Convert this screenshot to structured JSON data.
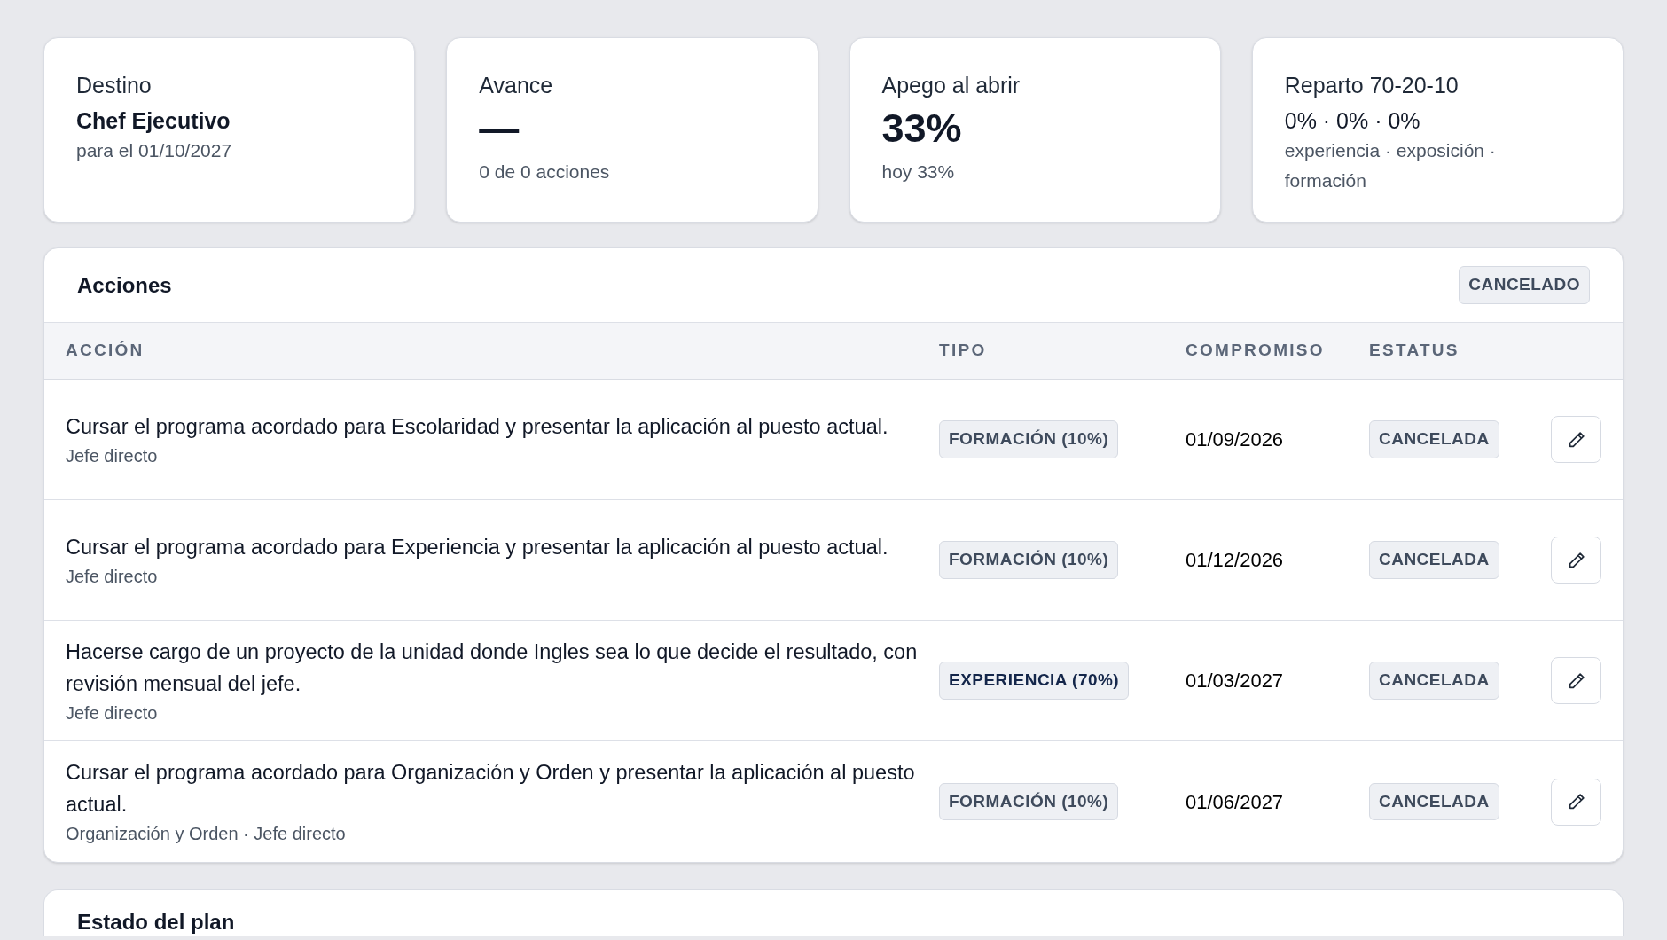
{
  "cards": [
    {
      "label": "Destino",
      "value": "Chef Ejecutivo",
      "kind": "title",
      "sub": "para el 01/10/2027"
    },
    {
      "label": "Avance",
      "value": "—",
      "kind": "big",
      "sub": "0 de 0 acciones"
    },
    {
      "label": "Apego al abrir",
      "value": "33%",
      "kind": "big",
      "sub": "hoy 33%"
    },
    {
      "label": "Reparto 70-20-10",
      "value": "0% · 0% · 0%",
      "kind": "plain",
      "sub": "experiencia · exposición · formación"
    }
  ],
  "actions": {
    "title": "Acciones",
    "status_badge": "CANCELADO",
    "columns": [
      "ACCIÓN",
      "TIPO",
      "COMPROMISO",
      "ESTATUS"
    ],
    "rows": [
      {
        "action": "Cursar el programa acordado para Escolaridad y presentar la aplicación al puesto actual.",
        "meta": "Jefe directo",
        "type": "FORMACIÓN (10%)",
        "kind": "formacion",
        "date": "01/09/2026",
        "status": "CANCELADA"
      },
      {
        "action": "Cursar el programa acordado para Experiencia y presentar la aplicación al puesto actual.",
        "meta": "Jefe directo",
        "type": "FORMACIÓN (10%)",
        "kind": "formacion",
        "date": "01/12/2026",
        "status": "CANCELADA"
      },
      {
        "action": "Hacerse cargo de un proyecto de la unidad donde Ingles sea lo que decide el resultado, con revisión mensual del jefe.",
        "meta": "Jefe directo",
        "type": "EXPERIENCIA (70%)",
        "kind": "experiencia",
        "date": "01/03/2027",
        "status": "CANCELADA"
      },
      {
        "action": "Cursar el programa acordado para Organización y Orden y presentar la aplicación al puesto actual.",
        "meta": "Organización y Orden · Jefe directo",
        "type": "FORMACIÓN (10%)",
        "kind": "formacion",
        "date": "01/06/2027",
        "status": "CANCELADA"
      }
    ]
  },
  "plan_status": {
    "title": "Estado del plan"
  }
}
